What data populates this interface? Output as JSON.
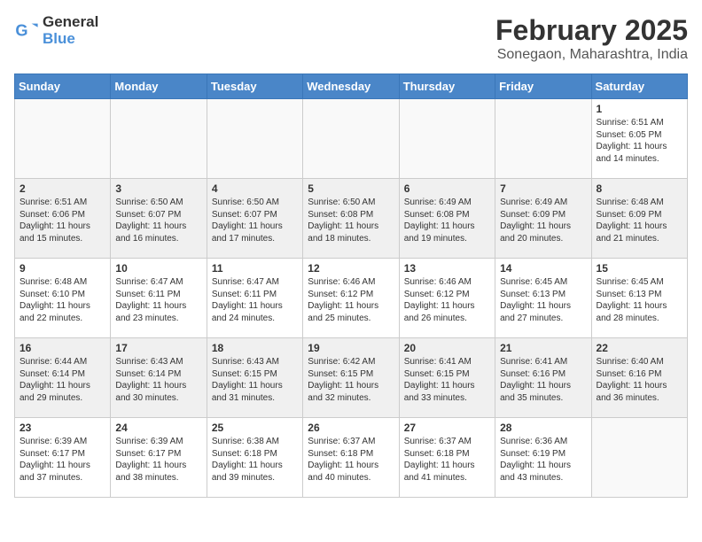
{
  "logo": {
    "line1": "General",
    "line2": "Blue"
  },
  "title": "February 2025",
  "location": "Sonegaon, Maharashtra, India",
  "days_of_week": [
    "Sunday",
    "Monday",
    "Tuesday",
    "Wednesday",
    "Thursday",
    "Friday",
    "Saturday"
  ],
  "weeks": [
    [
      {
        "day": "",
        "text": ""
      },
      {
        "day": "",
        "text": ""
      },
      {
        "day": "",
        "text": ""
      },
      {
        "day": "",
        "text": ""
      },
      {
        "day": "",
        "text": ""
      },
      {
        "day": "",
        "text": ""
      },
      {
        "day": "1",
        "text": "Sunrise: 6:51 AM\nSunset: 6:05 PM\nDaylight: 11 hours and 14 minutes."
      }
    ],
    [
      {
        "day": "2",
        "text": "Sunrise: 6:51 AM\nSunset: 6:06 PM\nDaylight: 11 hours and 15 minutes."
      },
      {
        "day": "3",
        "text": "Sunrise: 6:50 AM\nSunset: 6:07 PM\nDaylight: 11 hours and 16 minutes."
      },
      {
        "day": "4",
        "text": "Sunrise: 6:50 AM\nSunset: 6:07 PM\nDaylight: 11 hours and 17 minutes."
      },
      {
        "day": "5",
        "text": "Sunrise: 6:50 AM\nSunset: 6:08 PM\nDaylight: 11 hours and 18 minutes."
      },
      {
        "day": "6",
        "text": "Sunrise: 6:49 AM\nSunset: 6:08 PM\nDaylight: 11 hours and 19 minutes."
      },
      {
        "day": "7",
        "text": "Sunrise: 6:49 AM\nSunset: 6:09 PM\nDaylight: 11 hours and 20 minutes."
      },
      {
        "day": "8",
        "text": "Sunrise: 6:48 AM\nSunset: 6:09 PM\nDaylight: 11 hours and 21 minutes."
      }
    ],
    [
      {
        "day": "9",
        "text": "Sunrise: 6:48 AM\nSunset: 6:10 PM\nDaylight: 11 hours and 22 minutes."
      },
      {
        "day": "10",
        "text": "Sunrise: 6:47 AM\nSunset: 6:11 PM\nDaylight: 11 hours and 23 minutes."
      },
      {
        "day": "11",
        "text": "Sunrise: 6:47 AM\nSunset: 6:11 PM\nDaylight: 11 hours and 24 minutes."
      },
      {
        "day": "12",
        "text": "Sunrise: 6:46 AM\nSunset: 6:12 PM\nDaylight: 11 hours and 25 minutes."
      },
      {
        "day": "13",
        "text": "Sunrise: 6:46 AM\nSunset: 6:12 PM\nDaylight: 11 hours and 26 minutes."
      },
      {
        "day": "14",
        "text": "Sunrise: 6:45 AM\nSunset: 6:13 PM\nDaylight: 11 hours and 27 minutes."
      },
      {
        "day": "15",
        "text": "Sunrise: 6:45 AM\nSunset: 6:13 PM\nDaylight: 11 hours and 28 minutes."
      }
    ],
    [
      {
        "day": "16",
        "text": "Sunrise: 6:44 AM\nSunset: 6:14 PM\nDaylight: 11 hours and 29 minutes."
      },
      {
        "day": "17",
        "text": "Sunrise: 6:43 AM\nSunset: 6:14 PM\nDaylight: 11 hours and 30 minutes."
      },
      {
        "day": "18",
        "text": "Sunrise: 6:43 AM\nSunset: 6:15 PM\nDaylight: 11 hours and 31 minutes."
      },
      {
        "day": "19",
        "text": "Sunrise: 6:42 AM\nSunset: 6:15 PM\nDaylight: 11 hours and 32 minutes."
      },
      {
        "day": "20",
        "text": "Sunrise: 6:41 AM\nSunset: 6:15 PM\nDaylight: 11 hours and 33 minutes."
      },
      {
        "day": "21",
        "text": "Sunrise: 6:41 AM\nSunset: 6:16 PM\nDaylight: 11 hours and 35 minutes."
      },
      {
        "day": "22",
        "text": "Sunrise: 6:40 AM\nSunset: 6:16 PM\nDaylight: 11 hours and 36 minutes."
      }
    ],
    [
      {
        "day": "23",
        "text": "Sunrise: 6:39 AM\nSunset: 6:17 PM\nDaylight: 11 hours and 37 minutes."
      },
      {
        "day": "24",
        "text": "Sunrise: 6:39 AM\nSunset: 6:17 PM\nDaylight: 11 hours and 38 minutes."
      },
      {
        "day": "25",
        "text": "Sunrise: 6:38 AM\nSunset: 6:18 PM\nDaylight: 11 hours and 39 minutes."
      },
      {
        "day": "26",
        "text": "Sunrise: 6:37 AM\nSunset: 6:18 PM\nDaylight: 11 hours and 40 minutes."
      },
      {
        "day": "27",
        "text": "Sunrise: 6:37 AM\nSunset: 6:18 PM\nDaylight: 11 hours and 41 minutes."
      },
      {
        "day": "28",
        "text": "Sunrise: 6:36 AM\nSunset: 6:19 PM\nDaylight: 11 hours and 43 minutes."
      },
      {
        "day": "",
        "text": ""
      }
    ]
  ]
}
